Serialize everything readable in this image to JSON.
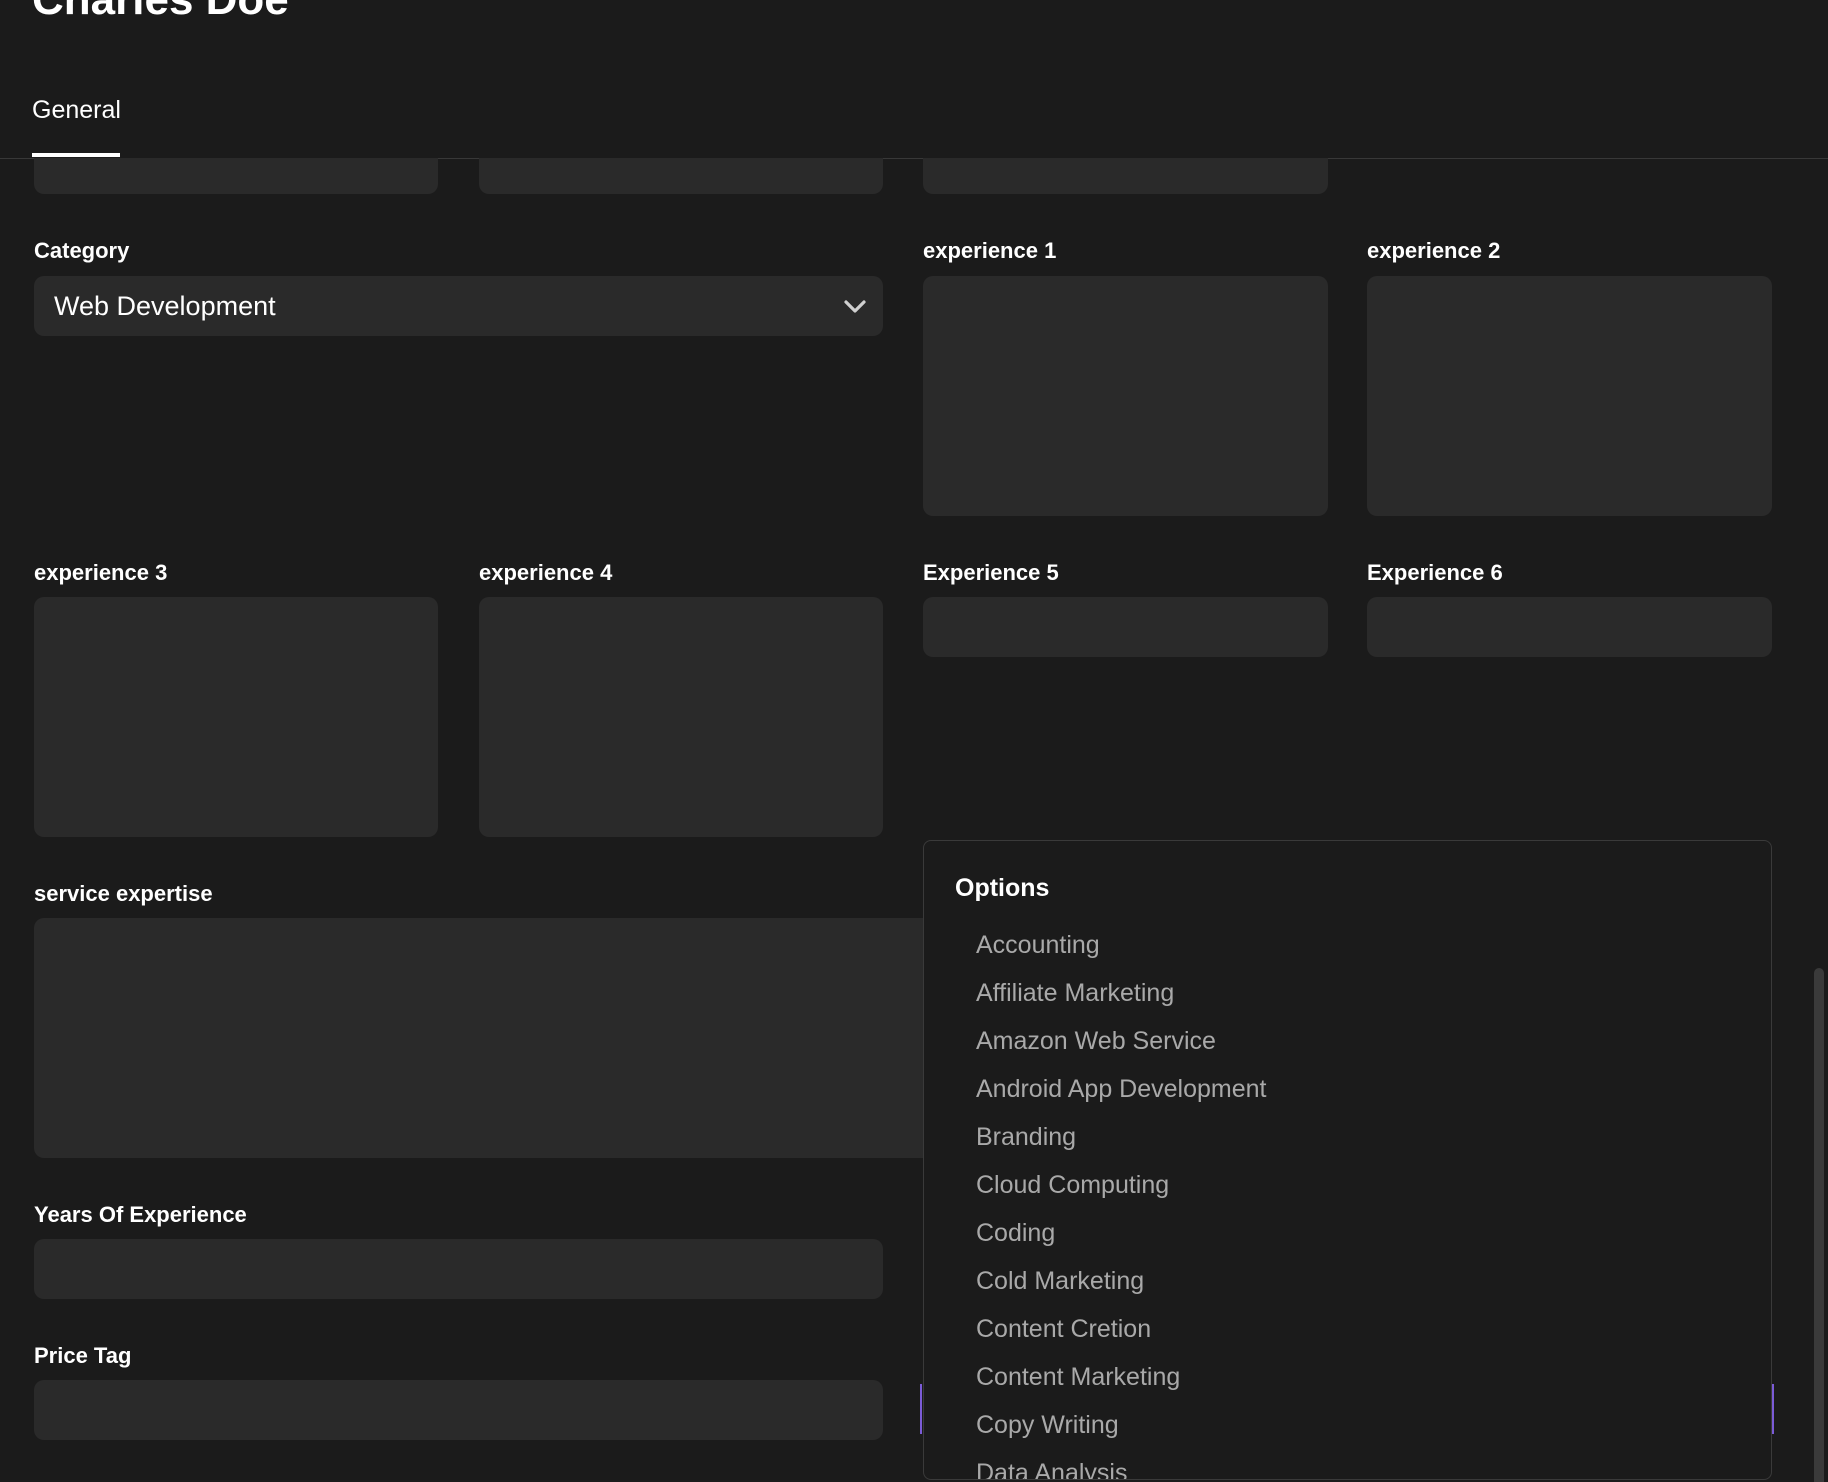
{
  "page": {
    "title": "Charles Doe"
  },
  "tabs": [
    {
      "label": "General",
      "active": true
    }
  ],
  "form": {
    "category": {
      "label": "Category",
      "value": "Web Development"
    },
    "experience_1": {
      "label": "experience 1",
      "value": ""
    },
    "experience_2": {
      "label": "experience 2",
      "value": ""
    },
    "experience_3": {
      "label": "experience 3",
      "value": ""
    },
    "experience_4": {
      "label": "experience 4",
      "value": ""
    },
    "experience_5": {
      "label": "Experience 5",
      "value": ""
    },
    "experience_6": {
      "label": "Experience 6",
      "value": ""
    },
    "service_expertise": {
      "label": "service expertise",
      "value": ""
    },
    "years_of_experience": {
      "label": "Years Of Experience",
      "value": ""
    },
    "price_tag": {
      "label": "Price Tag",
      "value": ""
    }
  },
  "dropdown": {
    "heading": "Options",
    "options": [
      "Accounting",
      "Affiliate Marketing",
      "Amazon Web Service",
      "Android App Development",
      "Branding",
      "Cloud Computing",
      "Coding",
      "Cold Marketing",
      "Content Cretion",
      "Content Marketing",
      "Copy Writing",
      "Data Analysis"
    ]
  },
  "colors": {
    "background": "#1b1b1b",
    "field": "#2a2a2a",
    "accent": "#7b5bd6",
    "option_text": "#a9a9a9"
  },
  "icons": {
    "category_select": "chevron-down-icon"
  }
}
